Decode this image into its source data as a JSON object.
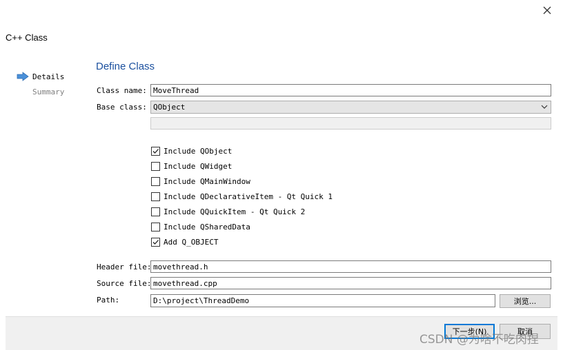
{
  "window": {
    "title": "C++ Class"
  },
  "sidebar": {
    "items": [
      {
        "label": "Details",
        "active": true
      },
      {
        "label": "Summary",
        "active": false
      }
    ]
  },
  "page": {
    "heading": "Define Class"
  },
  "form": {
    "class_name": {
      "label": "Class name:",
      "value": "MoveThread"
    },
    "base_class": {
      "label": "Base class:",
      "value": "QObject"
    },
    "checkboxes": [
      {
        "label": "Include QObject",
        "checked": true
      },
      {
        "label": "Include QWidget",
        "checked": false
      },
      {
        "label": "Include QMainWindow",
        "checked": false
      },
      {
        "label": "Include QDeclarativeItem - Qt Quick 1",
        "checked": false
      },
      {
        "label": "Include QQuickItem - Qt Quick 2",
        "checked": false
      },
      {
        "label": "Include QSharedData",
        "checked": false
      },
      {
        "label": "Add Q_OBJECT",
        "checked": true
      }
    ],
    "header_file": {
      "label": "Header file:",
      "value": "movethread.h"
    },
    "source_file": {
      "label": "Source file:",
      "value": "movethread.cpp"
    },
    "path": {
      "label": "Path:",
      "value": "D:\\project\\ThreadDemo"
    },
    "browse_label": "浏览..."
  },
  "footer": {
    "next_label": "下一步(N)",
    "cancel_label": "取消"
  },
  "watermark": "CSDN @为啥不吃肉捏",
  "colors": {
    "heading": "#1a4f9e",
    "active_arrow": "#4a90d9",
    "footer_bg": "#f0f0f0",
    "default_button_border": "#0078d7"
  }
}
